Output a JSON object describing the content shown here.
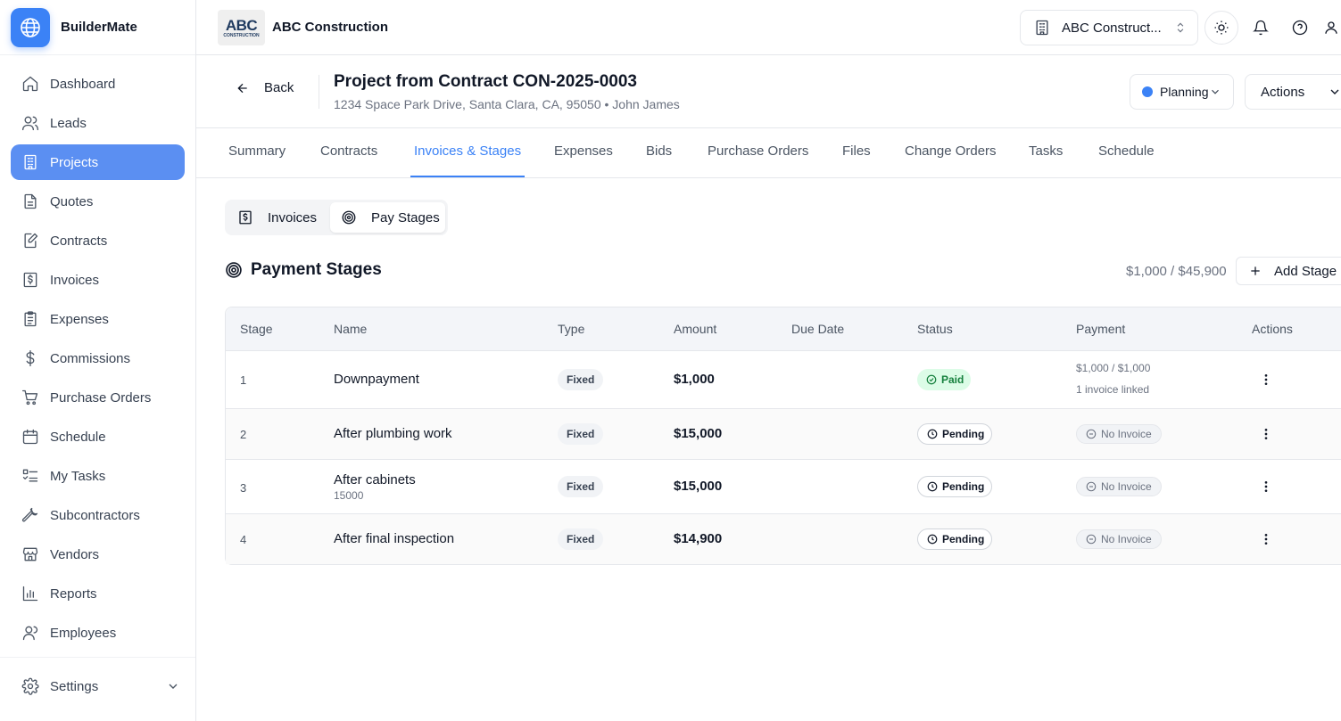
{
  "app": {
    "name": "BuilderMate"
  },
  "sidebar": {
    "items": [
      {
        "label": "Dashboard",
        "icon": "home-icon"
      },
      {
        "label": "Leads",
        "icon": "users-icon"
      },
      {
        "label": "Projects",
        "icon": "building-icon",
        "active": true
      },
      {
        "label": "Quotes",
        "icon": "document-icon"
      },
      {
        "label": "Contracts",
        "icon": "contract-icon"
      },
      {
        "label": "Invoices",
        "icon": "invoice-icon"
      },
      {
        "label": "Expenses",
        "icon": "clipboard-icon"
      },
      {
        "label": "Commissions",
        "icon": "dollar-icon"
      },
      {
        "label": "Purchase Orders",
        "icon": "cart-icon"
      },
      {
        "label": "Schedule",
        "icon": "calendar-icon"
      },
      {
        "label": "My Tasks",
        "icon": "tasks-icon"
      },
      {
        "label": "Subcontractors",
        "icon": "wrench-icon"
      },
      {
        "label": "Vendors",
        "icon": "store-icon"
      },
      {
        "label": "Reports",
        "icon": "chart-icon"
      },
      {
        "label": "Employees",
        "icon": "person-icon"
      }
    ],
    "settings_label": "Settings"
  },
  "topbar": {
    "company_name": "ABC Construction",
    "logo_text_main": "ABC",
    "logo_text_sub": "CONSTRUCTION",
    "org_select": "ABC Construct..."
  },
  "header": {
    "back_label": "Back",
    "title": "Project from Contract CON-2025-0003",
    "subtitle": "1234 Space Park Drive, Santa Clara, CA, 95050 • John James",
    "status": "Planning",
    "actions_label": "Actions"
  },
  "tabs": [
    "Summary",
    "Contracts",
    "Invoices & Stages",
    "Expenses",
    "Bids",
    "Purchase Orders",
    "Files",
    "Change Orders",
    "Tasks",
    "Schedule"
  ],
  "active_tab": "Invoices & Stages",
  "segments": {
    "invoices": "Invoices",
    "pay_stages": "Pay Stages"
  },
  "section": {
    "title": "Payment Stages",
    "totals": "$1,000 / $45,900",
    "add_label": "Add Stage"
  },
  "table": {
    "columns": [
      "Stage",
      "Name",
      "Type",
      "Amount",
      "Due Date",
      "Status",
      "Payment",
      "Actions"
    ],
    "rows": [
      {
        "stage": "1",
        "name": "Downpayment",
        "note": "",
        "type": "Fixed",
        "amount": "$1,000",
        "due": "",
        "status": "Paid",
        "payment_amount": "$1,000 / $1,000",
        "payment_note": "1 invoice linked"
      },
      {
        "stage": "2",
        "name": "After plumbing work",
        "note": "",
        "type": "Fixed",
        "amount": "$15,000",
        "due": "",
        "status": "Pending",
        "payment_badge": "No Invoice"
      },
      {
        "stage": "3",
        "name": "After cabinets",
        "note": "15000",
        "type": "Fixed",
        "amount": "$15,000",
        "due": "",
        "status": "Pending",
        "payment_badge": "No Invoice"
      },
      {
        "stage": "4",
        "name": "After final inspection",
        "note": "",
        "type": "Fixed",
        "amount": "$14,900",
        "due": "",
        "status": "Pending",
        "payment_badge": "No Invoice"
      }
    ]
  },
  "colors": {
    "accent": "#3b82f6",
    "active_nav": "#5b8ff2",
    "paid_bg": "#dcfce7",
    "paid_text": "#15803d"
  }
}
